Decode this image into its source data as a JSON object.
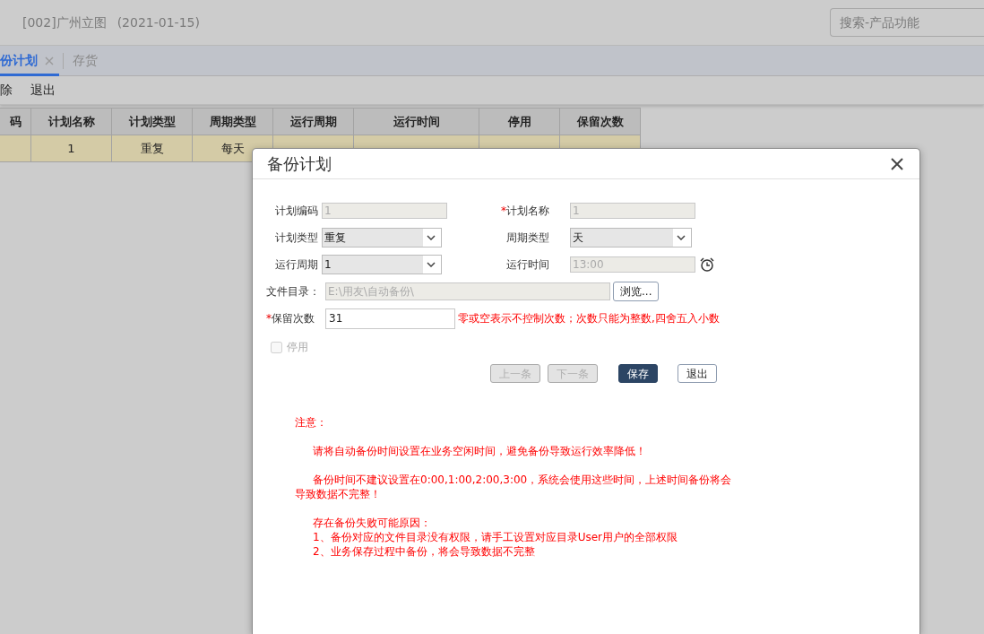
{
  "header": {
    "company": "[002]广州立图",
    "date": "(2021-01-15)",
    "search": {
      "placeholder": "搜索-产品功能"
    }
  },
  "tabs": [
    {
      "label": "份计划",
      "selected": true,
      "closable": true
    },
    {
      "label": "存货",
      "selected": false,
      "closable": false
    }
  ],
  "toolbar": [
    "除",
    "退出"
  ],
  "table": {
    "columns": [
      "码",
      "计划名称",
      "计划类型",
      "周期类型",
      "运行周期",
      "运行时间",
      "停用",
      "保留次数"
    ],
    "rows": [
      {
        "selected": true,
        "cells": [
          null,
          "1",
          "重复",
          "每天",
          null,
          null,
          null,
          null
        ]
      }
    ]
  },
  "dialog": {
    "title": "备份计划",
    "rows": [
      {
        "fields": [
          {
            "kind": "text",
            "label": "计划编码",
            "value": "1",
            "disabled": true
          },
          {
            "kind": "text",
            "required_mark": "*",
            "label": "计划名称",
            "value": "1",
            "disabled": true
          }
        ]
      },
      {
        "fields": [
          {
            "kind": "select",
            "label": "计划类型",
            "value": "重复"
          },
          {
            "kind": "select",
            "label": "周期类型",
            "value": "天"
          }
        ]
      },
      {
        "fields": [
          {
            "kind": "select",
            "label": "运行周期",
            "value": "1"
          },
          {
            "kind": "time",
            "label": "运行时间",
            "value": "13:00",
            "disabled": true
          }
        ]
      }
    ],
    "directory": {
      "label": "文件目录：",
      "value": "E:\\用友\\自动备份\\",
      "disabled": true,
      "button": "浏览..."
    },
    "retain": {
      "required_mark": "*",
      "label": "保留次数",
      "value": "31",
      "hint": "零或空表示不控制次数；次数只能为整数,四舍五入小数"
    },
    "stop": {
      "label": "停用",
      "checked": false,
      "disabled": true
    },
    "buttons": [
      {
        "label": "上一条",
        "kind": "default",
        "disabled": true
      },
      {
        "label": "下一条",
        "kind": "default",
        "disabled": true
      },
      {
        "label": "保存",
        "kind": "primary",
        "disabled": false
      },
      {
        "label": "退出",
        "kind": "default",
        "disabled": false
      }
    ],
    "notes": {
      "title": "注意：",
      "paragraphs": [
        {
          "lines": [
            "请将自动备份时间设置在业务空闲时间，避免备份导致运行效率降低！"
          ]
        },
        {
          "lines": [
            "备份时间不建议设置在0:00,1:00,2:00,3:00，系统会使用这些时间，上述时间备份将会导致数据不完整！"
          ]
        },
        {
          "lines": [
            "存在备份失败可能原因：",
            "1、备份对应的文件目录没有权限，请手工设置对应目录User用户的全部权限",
            "2、业务保存过程中备份，将会导致数据不完整"
          ]
        }
      ]
    }
  }
}
